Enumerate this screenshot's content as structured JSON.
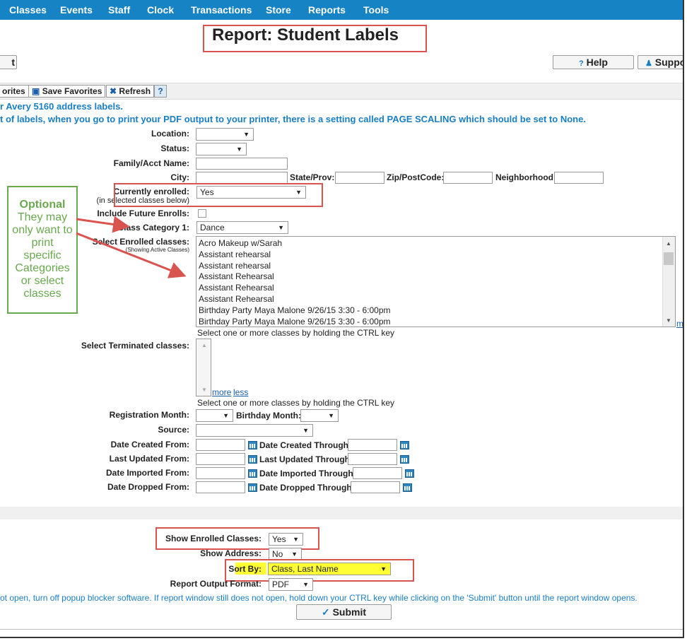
{
  "nav": {
    "items": [
      "Classes",
      "Events",
      "Staff",
      "Clock",
      "Transactions",
      "Store",
      "Reports",
      "Tools"
    ]
  },
  "page_title": "Report: Student Labels",
  "header_buttons": {
    "left_partial": "t",
    "help": "Help",
    "support": "Suppo"
  },
  "toolbar": {
    "favorites_partial": "orites",
    "save_favorites": "Save Favorites",
    "refresh": "Refresh",
    "help_icon": "?"
  },
  "info": {
    "line1": "r Avery 5160 address labels.",
    "line2": "t of labels, when you go to print your PDF output to your printer, there is a setting called PAGE SCALING which should be set to None."
  },
  "filters": {
    "location_label": "Location:",
    "status_label": "Status:",
    "family_label": "Family/Acct Name:",
    "city_label": "City:",
    "state_label": "State/Prov:",
    "zip_label": "Zip/PostCode:",
    "neighborhood_label": "Neighborhood:",
    "currently_enrolled_label": "Currently enrolled:",
    "currently_enrolled_sub": "(in selected classes below)",
    "currently_enrolled_value": "Yes",
    "include_future_label": "Include Future Enrolls:",
    "class_category_label": "Class Category 1:",
    "class_category_value": "Dance",
    "select_enrolled_label": "Select Enrolled classes:",
    "select_enrolled_sub": "(Showing Active Classes)",
    "enrolled_classes": [
      "Acro Makeup w/Sarah",
      "Assistant rehearsal",
      "Assistant rehearsal",
      "Assistant Rehearsal",
      "Assistant Rehearsal",
      "Assistant Rehearsal",
      "Birthday Party Maya Malone 9/26/15 3:30 - 6:00pm",
      "Birthday Party Maya Malone 9/26/15 3:30 - 6:00pm"
    ],
    "enrolled_more": "mo",
    "ctrl_hint": "Select one or more classes by holding the CTRL key",
    "select_terminated_label": "Select Terminated classes:",
    "more_link": "more",
    "less_link": "less",
    "registration_month_label": "Registration Month:",
    "birthday_month_label": "Birthday Month:",
    "source_label": "Source:",
    "date_created_from": "Date Created From:",
    "date_created_through": "Date Created Through:",
    "last_updated_from": "Last Updated From:",
    "last_updated_through": "Last Updated Through:",
    "date_imported_from": "Date Imported From:",
    "date_imported_through": "Date Imported Through:",
    "date_dropped_from": "Date Dropped From:",
    "date_dropped_through": "Date Dropped Through:"
  },
  "output": {
    "show_enrolled_label": "Show Enrolled Classes:",
    "show_enrolled_value": "Yes",
    "show_address_label": "Show Address:",
    "show_address_value": "No",
    "sort_by_label": "Sort By:",
    "sort_by_value": "Class, Last Name",
    "format_label": "Report Output Format:",
    "format_value": "PDF",
    "popup_info": "ot open, turn off popup blocker software. If report window still does not open, hold down your CTRL key while clicking on the 'Submit' button until the report window opens.",
    "submit": "Submit"
  },
  "annotation": {
    "title": "Optional",
    "body": [
      "They may",
      "only want to",
      "print",
      "specific",
      "Categories",
      "or select",
      "classes"
    ]
  },
  "colors": {
    "nav": "#1683c4",
    "annotation_red": "#d9534f",
    "annotation_green": "#6aa84f",
    "highlight": "#ffff33",
    "info_blue": "#1a7ec3"
  }
}
